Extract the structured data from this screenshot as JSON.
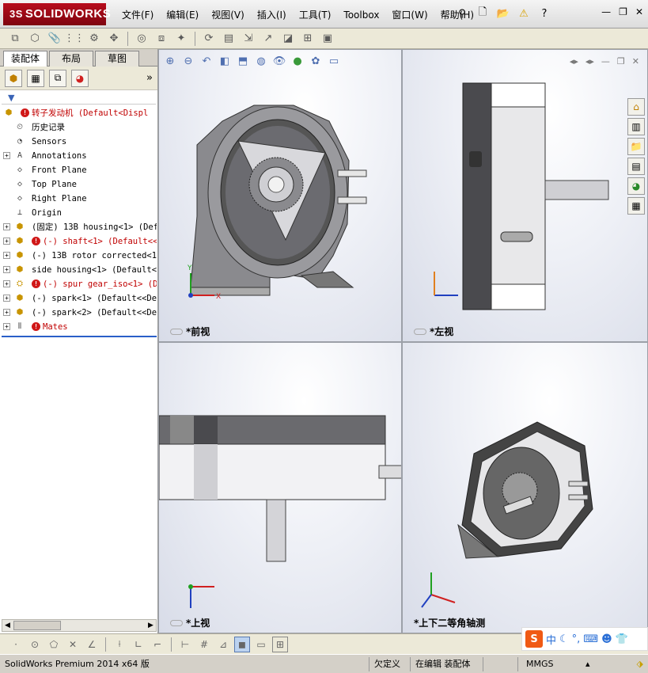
{
  "app": {
    "logo_text": "SOLIDWORKS",
    "logo_prefix": "3S"
  },
  "menu": [
    "文件(F)",
    "编辑(E)",
    "视图(V)",
    "插入(I)",
    "工具(T)",
    "Toolbox",
    "窗口(W)",
    "帮助(H)"
  ],
  "panel_tabs": [
    "装配体",
    "布局",
    "草图"
  ],
  "tree": [
    {
      "label": "转子发动机  (Default<Displ",
      "icon": "assembly-icon",
      "error": true,
      "red": true,
      "expand": false
    },
    {
      "label": "历史记录",
      "icon": "history-icon",
      "expand": false
    },
    {
      "label": "Sensors",
      "icon": "sensor-icon",
      "expand": false
    },
    {
      "label": "Annotations",
      "icon": "annotation-icon",
      "expand": true
    },
    {
      "label": "Front Plane",
      "icon": "plane-icon",
      "expand": false
    },
    {
      "label": "Top Plane",
      "icon": "plane-icon",
      "expand": false
    },
    {
      "label": "Right Plane",
      "icon": "plane-icon",
      "expand": false
    },
    {
      "label": "Origin",
      "icon": "origin-icon",
      "expand": false
    },
    {
      "label": "(固定) 13B housing<1> (Def",
      "icon": "part-icon",
      "expand": true
    },
    {
      "label": "(-) shaft<1> (Default<<",
      "icon": "part-icon",
      "error": true,
      "red": true,
      "expand": true
    },
    {
      "label": "(-) 13B rotor corrected<1>",
      "icon": "part-icon",
      "expand": true
    },
    {
      "label": "side housing<1> (Default<<",
      "icon": "part-icon",
      "expand": true
    },
    {
      "label": "(-) spur gear_iso<1> (D",
      "icon": "toolbox-part-icon",
      "error": true,
      "red": true,
      "expand": true
    },
    {
      "label": "(-) spark<1> (Default<<Def",
      "icon": "part-icon",
      "expand": true
    },
    {
      "label": "(-) spark<2> (Default<<Def",
      "icon": "part-icon",
      "expand": true
    },
    {
      "label": "Mates",
      "icon": "mates-icon",
      "error": true,
      "red": true,
      "expand": true
    }
  ],
  "views": {
    "front": "*前视",
    "left": "*左视",
    "top": "*上视",
    "iso": "*上下二等角轴测"
  },
  "axes": {
    "x": "X",
    "y": "Y",
    "z": "Z"
  },
  "ime": {
    "brand": "S",
    "mode": "中"
  },
  "status": {
    "product": "SolidWorks Premium 2014 x64 版",
    "custom": "欠定义",
    "editing": "在编辑 装配体",
    "units": "MMGS"
  },
  "colors": {
    "logo_red": "#a80a18",
    "error_red": "#d01818",
    "axis_x": "#d02020",
    "axis_y": "#20a020",
    "axis_z": "#2040c0"
  }
}
